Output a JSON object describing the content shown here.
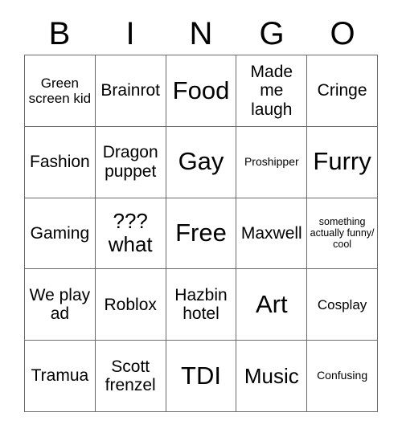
{
  "card": {
    "title": "BINGO",
    "header_letters": [
      "B",
      "I",
      "N",
      "G",
      "O"
    ],
    "colors": {
      "background": "#ffffff",
      "grid_line": "#6b6b6b",
      "text": "#000000"
    },
    "rows": [
      [
        {
          "label": "Green screen kid",
          "size": "sm"
        },
        {
          "label": "Brainrot",
          "size": "md"
        },
        {
          "label": "Food",
          "size": "xl"
        },
        {
          "label": "Made me laugh",
          "size": "md"
        },
        {
          "label": "Cringe",
          "size": "md"
        }
      ],
      [
        {
          "label": "Fashion",
          "size": "md"
        },
        {
          "label": "Dragon puppet",
          "size": "md"
        },
        {
          "label": "Gay",
          "size": "xl"
        },
        {
          "label": "Proshipper",
          "size": "xs"
        },
        {
          "label": "Furry",
          "size": "xl"
        }
      ],
      [
        {
          "label": "Gaming",
          "size": "md"
        },
        {
          "label": "??? what",
          "size": "lg"
        },
        {
          "label": "Free",
          "size": "xl"
        },
        {
          "label": "Maxwell",
          "size": "md"
        },
        {
          "label": "something actually funny/ cool",
          "size": "xxs"
        }
      ],
      [
        {
          "label": "We play ad",
          "size": "md"
        },
        {
          "label": "Roblox",
          "size": "md"
        },
        {
          "label": "Hazbin hotel",
          "size": "md"
        },
        {
          "label": "Art",
          "size": "xl"
        },
        {
          "label": "Cosplay",
          "size": "sm"
        }
      ],
      [
        {
          "label": "Tramua",
          "size": "md"
        },
        {
          "label": "Scott frenzel",
          "size": "md"
        },
        {
          "label": "TDI",
          "size": "xl"
        },
        {
          "label": "Music",
          "size": "lg"
        },
        {
          "label": "Confusing",
          "size": "xs"
        }
      ]
    ]
  }
}
